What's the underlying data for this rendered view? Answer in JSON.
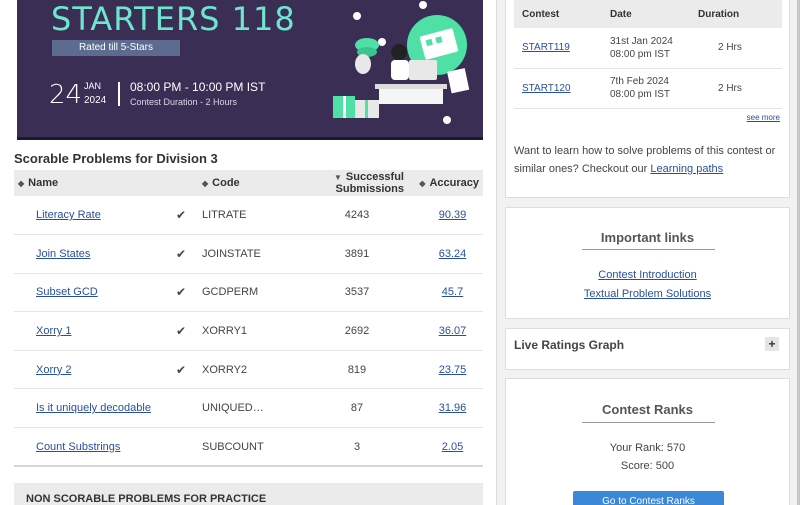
{
  "banner": {
    "title": "STARTERS 118",
    "rated": "Rated till 5-Stars",
    "day": "24",
    "month": "JAN",
    "year": "2024",
    "time": "08:00 PM - 10:00 PM IST",
    "duration": "Contest Duration - 2  Hours"
  },
  "problems": {
    "section_title": "Scorable Problems for Division 3",
    "headers": {
      "name": "Name",
      "code": "Code",
      "submissions": "Successful Submissions",
      "accuracy": "Accuracy"
    },
    "rows": [
      {
        "name": "Literacy Rate",
        "solved": true,
        "code": "LITRATE",
        "submissions": "4243",
        "accuracy": "90.39"
      },
      {
        "name": "Join States",
        "solved": true,
        "code": "JOINSTATE",
        "submissions": "3891",
        "accuracy": "63.24"
      },
      {
        "name": "Subset GCD",
        "solved": true,
        "code": "GCDPERM",
        "submissions": "3537",
        "accuracy": "45.7"
      },
      {
        "name": "Xorry 1",
        "solved": true,
        "code": "XORRY1",
        "submissions": "2692",
        "accuracy": "36.07"
      },
      {
        "name": "Xorry 2",
        "solved": true,
        "code": "XORRY2",
        "submissions": "819",
        "accuracy": "23.75"
      },
      {
        "name": "Is it uniquely decodable",
        "solved": false,
        "code": "UNIQUED…",
        "submissions": "87",
        "accuracy": "31.96"
      },
      {
        "name": "Count Substrings",
        "solved": false,
        "code": "SUBCOUNT",
        "submissions": "3",
        "accuracy": "2.05"
      }
    ],
    "nonscore_label": "NON SCORABLE PROBLEMS FOR PRACTICE"
  },
  "contests": {
    "headers": {
      "contest": "Contest",
      "date": "Date",
      "duration": "Duration"
    },
    "rows": [
      {
        "name": "START119",
        "date_line1": "31st Jan 2024",
        "date_line2": "08:00 pm IST",
        "duration": "2 Hrs"
      },
      {
        "name": "START120",
        "date_line1": "7th Feb 2024",
        "date_line2": "08:00 pm IST",
        "duration": "2 Hrs"
      }
    ],
    "see_more": "see more",
    "learn_text": "Want to learn how to solve problems of this contest or similar ones? Checkout our ",
    "learn_link": "Learning paths"
  },
  "important_links": {
    "heading": "Important links",
    "links": [
      "Contest Introduction",
      "Textual Problem Solutions"
    ]
  },
  "live_graph": {
    "label": "Live Ratings Graph",
    "expand": "+"
  },
  "ranks": {
    "heading": "Contest Ranks",
    "your_rank": "Your Rank: 570",
    "score": "Score: 500",
    "button": "Go to Contest Ranks"
  },
  "colors": {
    "banner_bg": "#3a2e55",
    "banner_title": "#6ee6cf",
    "link": "#2a4fa0",
    "check": "#5cb85c",
    "button": "#3b88d8"
  }
}
